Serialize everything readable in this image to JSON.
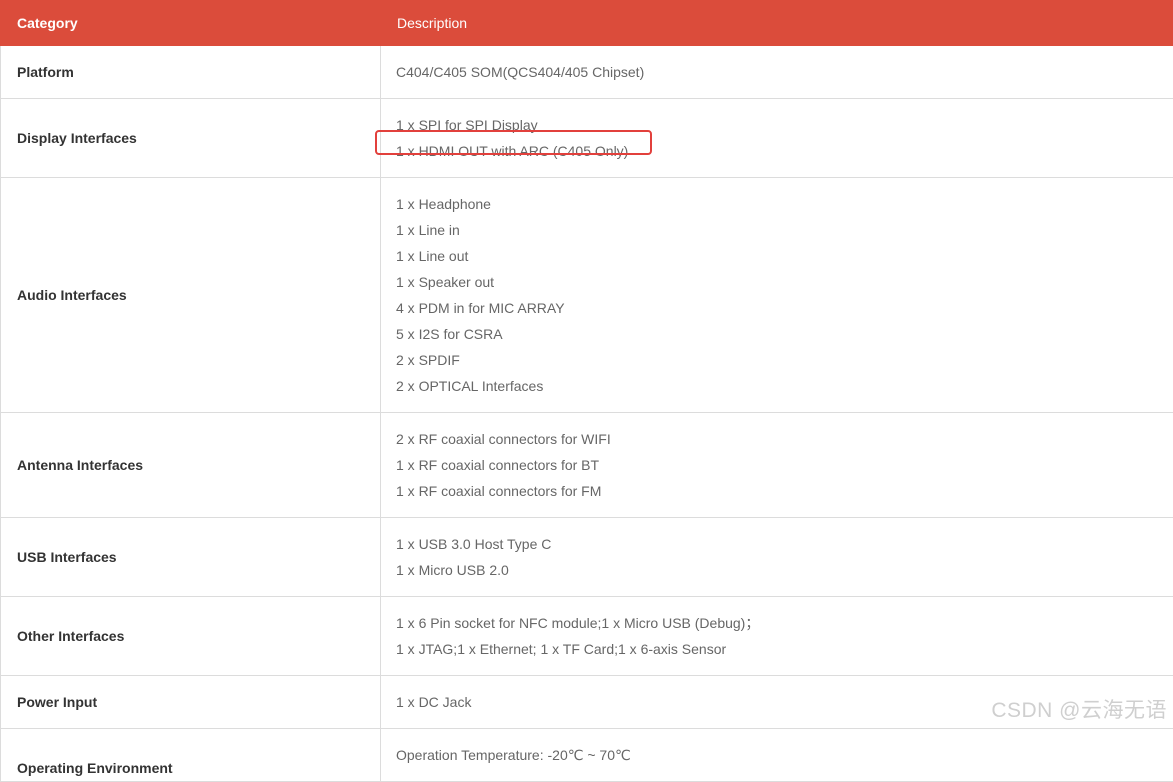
{
  "table": {
    "headers": {
      "category": "Category",
      "description": "Description"
    },
    "rows": [
      {
        "category": "Platform",
        "lines": [
          "C404/C405 SOM(QCS404/405 Chipset)"
        ]
      },
      {
        "category": "Display Interfaces",
        "lines": [
          "1 x SPI for SPI Display",
          "1 x HDMI OUT with ARC (C405 Only)"
        ]
      },
      {
        "category": "Audio Interfaces",
        "lines": [
          "1 x Headphone",
          "1 x Line in",
          "1 x Line out",
          "1 x Speaker out",
          "4 x PDM in for MIC ARRAY",
          "5 x I2S for CSRA",
          "2 x SPDIF",
          "2 x OPTICAL Interfaces"
        ]
      },
      {
        "category": "Antenna Interfaces",
        "lines": [
          "2 x RF coaxial connectors for WIFI",
          "1 x RF coaxial connectors for BT",
          "1 x RF coaxial connectors for FM"
        ]
      },
      {
        "category": "USB Interfaces",
        "lines": [
          "1 x USB 3.0 Host Type C",
          "1 x Micro USB 2.0"
        ]
      },
      {
        "category": "Other Interfaces",
        "lines": [
          "1 x 6 Pin socket for NFC module;1 x Micro USB (Debug)；",
          "1 x JTAG;1 x Ethernet; 1 x TF Card;1 x 6-axis Sensor"
        ]
      },
      {
        "category": "Power Input",
        "lines": [
          "1 x DC Jack"
        ]
      },
      {
        "category": "Operating Environment",
        "lines": [
          "Operation Temperature: -20℃ ~ 70℃"
        ]
      }
    ]
  },
  "watermark": "CSDN @云海无语",
  "colors": {
    "header_bg": "#db4c3b",
    "highlight_border": "#e2403c",
    "border": "#dcdcdc"
  }
}
